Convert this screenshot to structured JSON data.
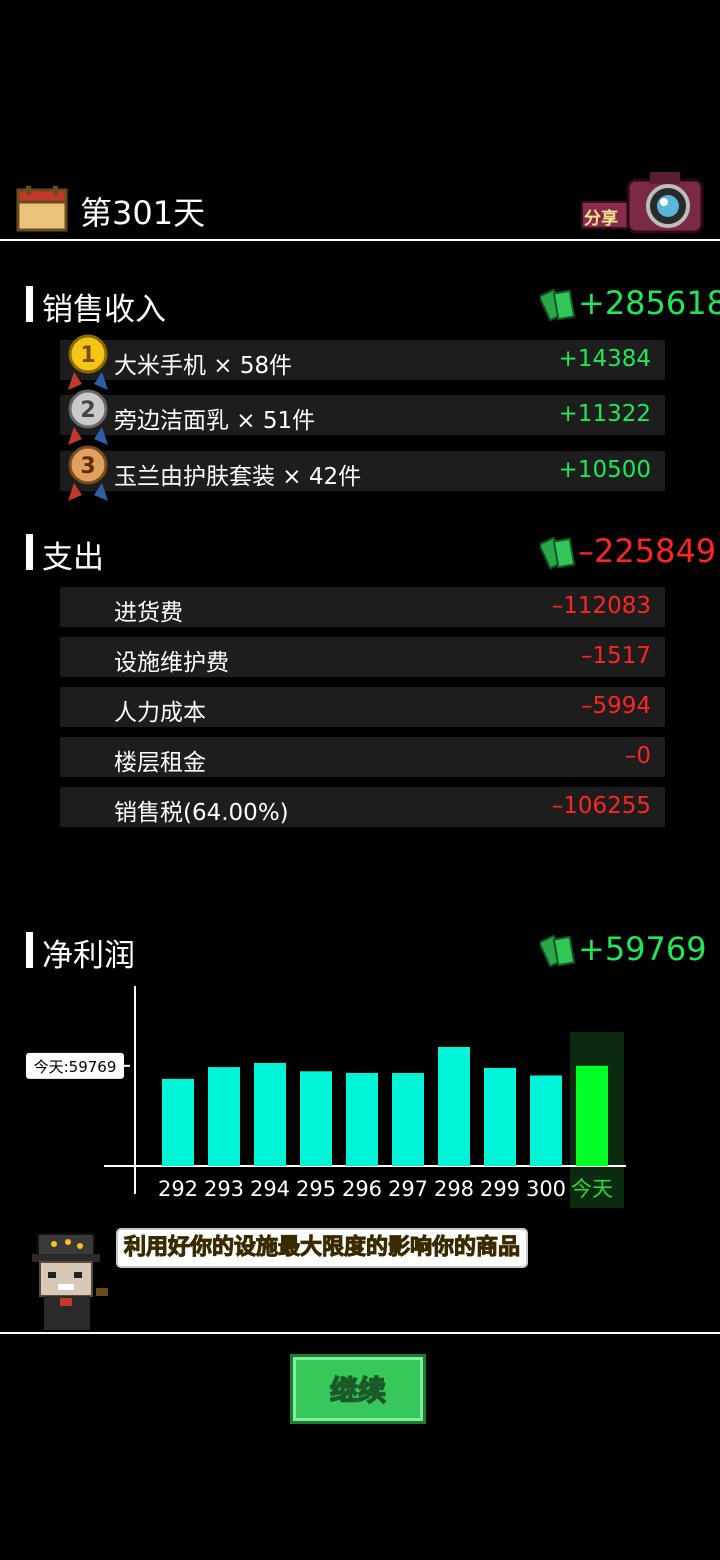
{
  "header": {
    "day_title": "第301天",
    "share_label": "分享"
  },
  "sales": {
    "title": "销售收入",
    "total": "+285618",
    "items": [
      {
        "rank": "1",
        "label": "大米手机 × 58件",
        "value": "+14384"
      },
      {
        "rank": "2",
        "label": "旁边洁面乳 × 51件",
        "value": "+11322"
      },
      {
        "rank": "3",
        "label": "玉兰由护肤套装 × 42件",
        "value": "+10500"
      }
    ]
  },
  "expense": {
    "title": "支出",
    "total": "–225849",
    "items": [
      {
        "label": "进货费",
        "value": "–112083"
      },
      {
        "label": "设施维护费",
        "value": "–1517"
      },
      {
        "label": "人力成本",
        "value": "–5994"
      },
      {
        "label": "楼层租金",
        "value": "–0"
      },
      {
        "label": "销售税(64.00%)",
        "value": "–106255"
      }
    ]
  },
  "profit": {
    "title": "净利润",
    "total": "+59769"
  },
  "chart_data": {
    "type": "bar",
    "categories": [
      "292",
      "293",
      "294",
      "295",
      "296",
      "297",
      "298",
      "299",
      "300",
      "今天"
    ],
    "values": [
      52000,
      59000,
      61500,
      56500,
      55500,
      55500,
      71000,
      58500,
      54000,
      59769
    ],
    "ylim": [
      0,
      105000
    ],
    "highlight_index": 9,
    "today_label": "今天:59769",
    "colors": {
      "bar": "#00f5d8",
      "today_bar": "#00ff24",
      "today_bg": "#0c2a10",
      "today_tick": "#2bd63c"
    }
  },
  "tip": {
    "text": "利用好你的设施最大限度的影响你的商品"
  },
  "continue_label": "继续",
  "colors": {
    "positive": "#1de85a",
    "negative": "#ff2424",
    "row_bg": "#1d1d1d"
  }
}
